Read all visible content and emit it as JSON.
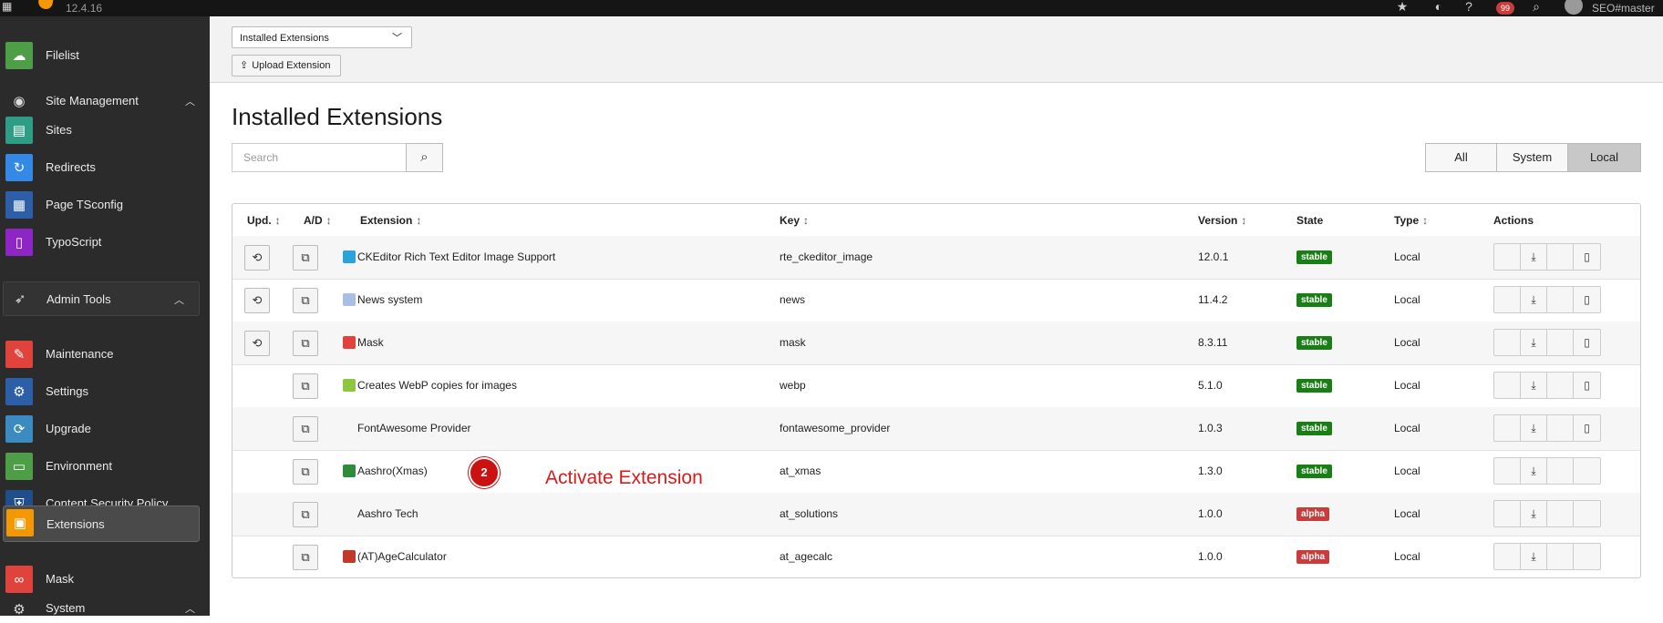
{
  "topbar": {
    "version": "12.4.16",
    "notifications_count": "99",
    "user": "SEO#master"
  },
  "sidebar": {
    "items": [
      {
        "label": "Filelist",
        "icon": "cloud-icon",
        "color": "#4d9e46"
      },
      {
        "label": "Site Management",
        "icon": "globe-icon",
        "group": true
      },
      {
        "label": "Sites",
        "icon": "sitemap-icon",
        "color": "#2f9c85"
      },
      {
        "label": "Redirects",
        "icon": "redirect-icon",
        "color": "#3489e6"
      },
      {
        "label": "Page TSconfig",
        "icon": "layout-icon",
        "color": "#2d5ea8"
      },
      {
        "label": "TypoScript",
        "icon": "script-icon",
        "color": "#8e26c6"
      },
      {
        "label": "Admin Tools",
        "icon": "rocket-icon",
        "group": true
      },
      {
        "label": "Maintenance",
        "icon": "wrench-icon",
        "color": "#e0433c"
      },
      {
        "label": "Settings",
        "icon": "gear-icon",
        "color": "#2d5ea8"
      },
      {
        "label": "Upgrade",
        "icon": "refresh-icon",
        "color": "#3b8ac0"
      },
      {
        "label": "Environment",
        "icon": "monitor-icon",
        "color": "#4d9e46"
      },
      {
        "label": "Content Security Policy",
        "icon": "shield-icon",
        "color": "#1e4f8a"
      },
      {
        "label": "Extensions",
        "icon": "box-icon",
        "color": "#f49700",
        "active": true
      },
      {
        "label": "Mask",
        "icon": "mask-icon",
        "color": "#e0433c"
      },
      {
        "label": "System",
        "icon": "gear-icon",
        "group": true
      }
    ]
  },
  "docbar": {
    "select_value": "Installed Extensions",
    "upload_label": "Upload Extension"
  },
  "page_title": "Installed Extensions",
  "search": {
    "placeholder": "Search"
  },
  "filters": [
    {
      "label": "All",
      "active": false
    },
    {
      "label": "System",
      "active": false
    },
    {
      "label": "Local",
      "active": true
    }
  ],
  "table": {
    "columns": {
      "upd": "Upd.",
      "ad": "A/D",
      "extension": "Extension",
      "key": "Key",
      "version": "Version",
      "state": "State",
      "type": "Type",
      "actions": "Actions"
    },
    "rows": [
      {
        "name": "CKEditor Rich Text Editor Image Support",
        "key": "rte_ckeditor_image",
        "version": "12.0.1",
        "state": "stable",
        "type": "Local",
        "update": true,
        "icon_color": "#29a3d9",
        "docs": true
      },
      {
        "name": "News system",
        "key": "news",
        "version": "11.4.2",
        "state": "stable",
        "type": "Local",
        "update": true,
        "icon_color": "#a9c0e4",
        "docs": true
      },
      {
        "name": "Mask",
        "key": "mask",
        "version": "8.3.11",
        "state": "stable",
        "type": "Local",
        "update": true,
        "icon_color": "#e0433c",
        "docs": true
      },
      {
        "name": "Creates WebP copies for images",
        "key": "webp",
        "version": "5.1.0",
        "state": "stable",
        "type": "Local",
        "update": false,
        "icon_color": "#8dc63f",
        "docs": true
      },
      {
        "name": "FontAwesome Provider",
        "key": "fontawesome_provider",
        "version": "1.0.3",
        "state": "stable",
        "type": "Local",
        "update": false,
        "icon_color": "",
        "docs": true
      },
      {
        "name": "Aashro(Xmas)",
        "key": "at_xmas",
        "version": "1.3.0",
        "state": "stable",
        "type": "Local",
        "update": false,
        "icon_color": "#2e8b3a",
        "docs": false
      },
      {
        "name": "Aashro Tech",
        "key": "at_solutions",
        "version": "1.0.0",
        "state": "alpha",
        "type": "Local",
        "update": false,
        "icon_color": "",
        "docs": false
      },
      {
        "name": "(AT)AgeCalculator",
        "key": "at_agecalc",
        "version": "1.0.0",
        "state": "alpha",
        "type": "Local",
        "update": false,
        "icon_color": "#c0392b",
        "docs": false
      }
    ]
  },
  "annotation": {
    "step": "2",
    "text": "Activate Extension"
  }
}
